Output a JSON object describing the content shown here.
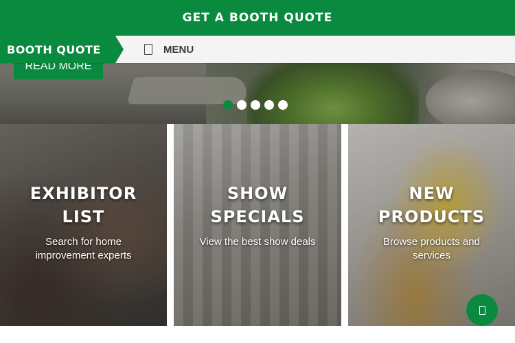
{
  "topbar": {
    "cta_label": "GET A BOOTH QUOTE"
  },
  "navbar": {
    "brand": "BOOTH QUOTE",
    "menu_icon": "hamburger-icon",
    "menu_label": "MENU"
  },
  "hero": {
    "read_more_label": "READ MORE",
    "slides_count": 5,
    "active_slide": 1
  },
  "tiles": [
    {
      "title_line1": "EXHIBITOR",
      "title_line2": "LIST",
      "description": "Search for home improvement experts"
    },
    {
      "title_line1": "SHOW",
      "title_line2": "SPECIALS",
      "description": "View the best show deals"
    },
    {
      "title_line1": "NEW",
      "title_line2": "PRODUCTS",
      "description": "Browse products and services"
    }
  ],
  "floating_button": {
    "icon": "chat-icon"
  },
  "colors": {
    "brand_green": "#0a8a3f",
    "nav_bg": "#f4f4f4",
    "white": "#ffffff"
  }
}
